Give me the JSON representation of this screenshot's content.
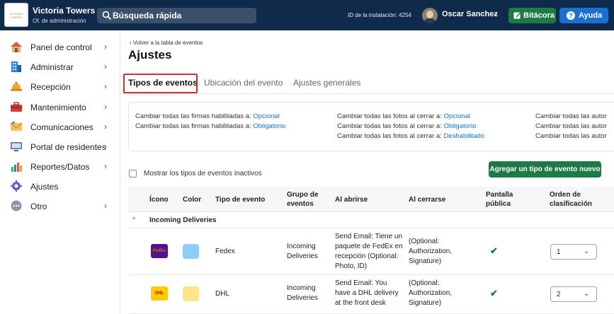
{
  "header": {
    "brand_name": "Victoria Towers",
    "brand_sub": "Of. de administración",
    "logo_text": "VICTORIA TOWERS",
    "search_placeholder": "Búsqueda rápida",
    "installation_id": "ID de la instalación: 4254",
    "user_name": "Oscar Sanchez",
    "bitacora_label": "Bitácora",
    "help_label": "Ayuda"
  },
  "sidebar": {
    "items": [
      {
        "label": "Panel de control",
        "icon": "house-icon",
        "chevron": true
      },
      {
        "label": "Administrar",
        "icon": "building-icon",
        "chevron": true
      },
      {
        "label": "Recepción",
        "icon": "bell-icon",
        "chevron": true
      },
      {
        "label": "Mantenimiento",
        "icon": "toolbox-icon",
        "chevron": true
      },
      {
        "label": "Comunicaciones",
        "icon": "mail-icon",
        "chevron": true
      },
      {
        "label": "Portal de residentes",
        "icon": "monitor-icon",
        "chevron": true
      },
      {
        "label": "Reportes/Datos",
        "icon": "chart-icon",
        "chevron": true
      },
      {
        "label": "Ajustes",
        "icon": "gear-icon",
        "chevron": false
      },
      {
        "label": "Otro",
        "icon": "more-icon",
        "chevron": true
      }
    ],
    "chevron_glyph": "›"
  },
  "page": {
    "back_link": "Volver a la tabla de eventos",
    "title": "Ajustes",
    "tabs": [
      "Tipos de eventos",
      "Ubicación del evento",
      "Ajustes generales"
    ]
  },
  "options": {
    "col1": [
      {
        "text": "Cambiar todas las firmas habilitadas a:",
        "value": "Opcional"
      },
      {
        "text": "Cambiar todas las firmas habilitadas a:",
        "value": "Obligatorio"
      }
    ],
    "col2": [
      {
        "text": "Cambiar todas las fotos al cerrar a:",
        "value": "Opcional"
      },
      {
        "text": "Cambiar todas las fotos al cerrar a:",
        "value": "Obligatorio"
      },
      {
        "text": "Cambiar todas las fotos al cerrar a:",
        "value": "Deshabilitado"
      }
    ],
    "col3": [
      {
        "text": "Cambiar todas las autor"
      },
      {
        "text": "Cambiar todas las autor"
      },
      {
        "text": "Cambiar todas las autor"
      }
    ]
  },
  "controls": {
    "show_inactive_label": "Mostrar los tipos de eventos inactivos",
    "add_button": "Agregar un tipo de evento nuevo"
  },
  "table": {
    "headers": {
      "icon": "Ícono",
      "color": "Color",
      "type": "Tipo de evento",
      "group_l1": "Grupo de",
      "group_l2": "eventos",
      "open": "Al abrirse",
      "close": "Al cerrarse",
      "public_l1": "Pantalla",
      "public_l2": "pública",
      "sort_l1": "Orden de",
      "sort_l2": "clasificación"
    },
    "group": {
      "label": "Incoming Deliveries",
      "caret": "^"
    },
    "rows": [
      {
        "icon_text": "FedEx",
        "icon_bg": "#4d148c",
        "icon_fg": "#ff6600",
        "color": "#8ecdf5",
        "type": "Fedex",
        "group": [
          "Incoming",
          "Deliveries"
        ],
        "open": [
          "Send Email: Tiene un",
          "paquete de FedEx en",
          "recepción (Optional:",
          "Photo, ID)"
        ],
        "close": [
          "(Optional:",
          "Authorization,",
          "Signature)"
        ],
        "public": "✔",
        "sort": "1"
      },
      {
        "icon_text": "DHL",
        "icon_bg": "#ffcc00",
        "icon_fg": "#d40511",
        "color": "#ffe58a",
        "type": "DHL",
        "group": [
          "Incoming",
          "Deliveries"
        ],
        "open": [
          "Send Email: You",
          "have a DHL delivery",
          "at the front desk"
        ],
        "close": [
          "(Optional:",
          "Authorization,",
          "Signature)"
        ],
        "public": "✔",
        "sort": "2"
      }
    ]
  },
  "colors": {
    "topbar": "#0f2a4a",
    "accent_green": "#1e7a44",
    "accent_blue": "#1a6fd1",
    "highlight_red": "#d32f2f"
  }
}
